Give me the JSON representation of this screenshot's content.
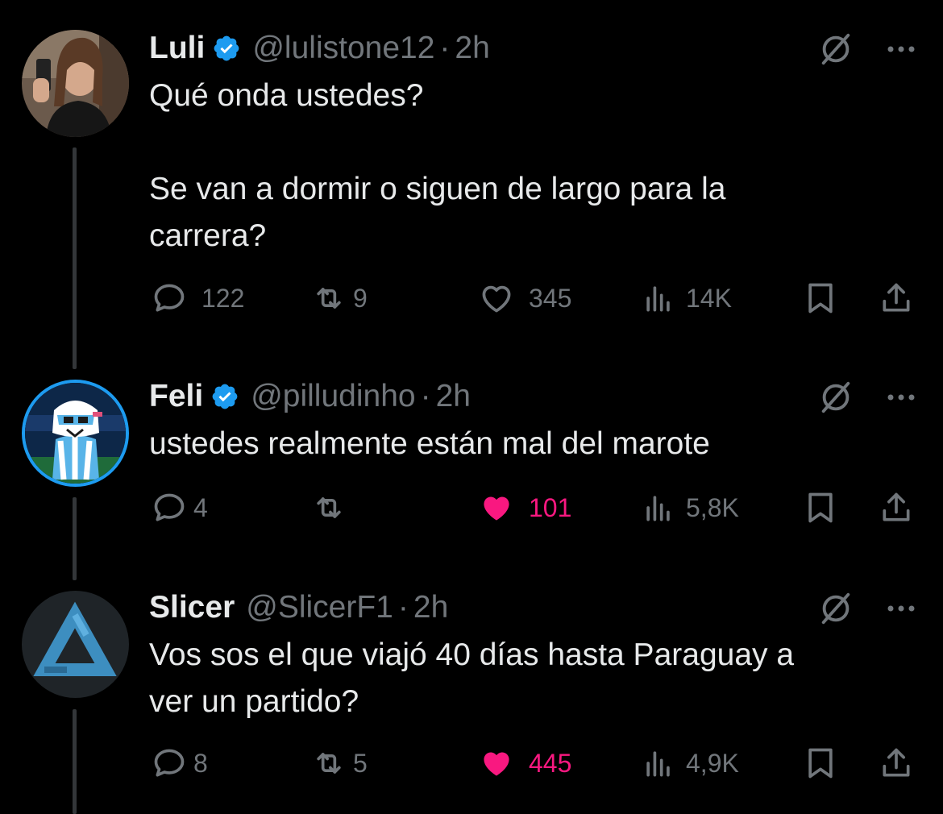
{
  "colors": {
    "background": "#000000",
    "text": "#e7e9ea",
    "muted": "#71767b",
    "verified": "#1d9bf0",
    "like_active": "#f91880"
  },
  "tweets": [
    {
      "name": "Luli",
      "verified": true,
      "handle": "@lulistone12",
      "separator": "·",
      "time": "2h",
      "text": "Qué onda ustedes?\n\nSe van a dormir o siguen de largo para la\ncarrera?",
      "replies": "122",
      "retweets": "9",
      "likes": "345",
      "liked": false,
      "views": "14K",
      "icons": [
        "reply-icon",
        "retweet-icon",
        "like-icon",
        "views-icon",
        "bookmark-icon",
        "share-icon"
      ]
    },
    {
      "name": "Feli",
      "verified": true,
      "handle": "@pilludinho",
      "separator": "·",
      "time": "2h",
      "text": "ustedes realmente están mal del marote",
      "replies": "4",
      "retweets": "",
      "likes": "101",
      "liked": true,
      "views": "5,8K"
    },
    {
      "name": "Slicer",
      "verified": false,
      "handle": "@SlicerF1",
      "separator": "·",
      "time": "2h",
      "text": "Vos sos el que viajó 40 días hasta Paraguay a\nver un partido?",
      "replies": "8",
      "retweets": "5",
      "likes": "445",
      "liked": true,
      "views": "4,9K"
    }
  ]
}
